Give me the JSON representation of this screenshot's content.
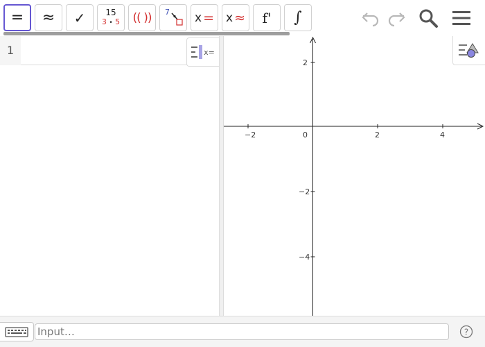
{
  "toolbar": {
    "buttons": [
      {
        "name": "equals-symbol",
        "text": "="
      },
      {
        "name": "approx-symbol",
        "text": "≈"
      },
      {
        "name": "checkmark",
        "text": "✓"
      },
      {
        "name": "factor",
        "text_top": "15",
        "text_bottom_a": "3",
        "text_bottom_dot": "•",
        "text_bottom_b": "5"
      },
      {
        "name": "expand",
        "text": "(( ))"
      },
      {
        "name": "substitute",
        "text": "7"
      },
      {
        "name": "solve",
        "text_x": "x",
        "text_op": "="
      },
      {
        "name": "nsolve",
        "text_x": "x",
        "text_op": "≈"
      },
      {
        "name": "derivative",
        "text": "f'"
      },
      {
        "name": "integral",
        "text": "∫"
      }
    ],
    "icons": [
      "undo-icon",
      "redo-icon",
      "search-icon",
      "menu-icon"
    ]
  },
  "algebra": {
    "row_number": "1",
    "input_value": "",
    "tools_label": "x="
  },
  "graphics": {
    "axes": {
      "x_ticks": [
        "−2",
        "0",
        "2",
        "4"
      ],
      "y_ticks": [
        "2",
        "−2",
        "−4"
      ]
    }
  },
  "inputbar": {
    "placeholder": "Input…",
    "help_label": "?"
  },
  "colors": {
    "accent": "#6557d2",
    "red": "#d32f2f",
    "blue": "#3f51b5",
    "gray_bar": "#9e9e9e"
  }
}
